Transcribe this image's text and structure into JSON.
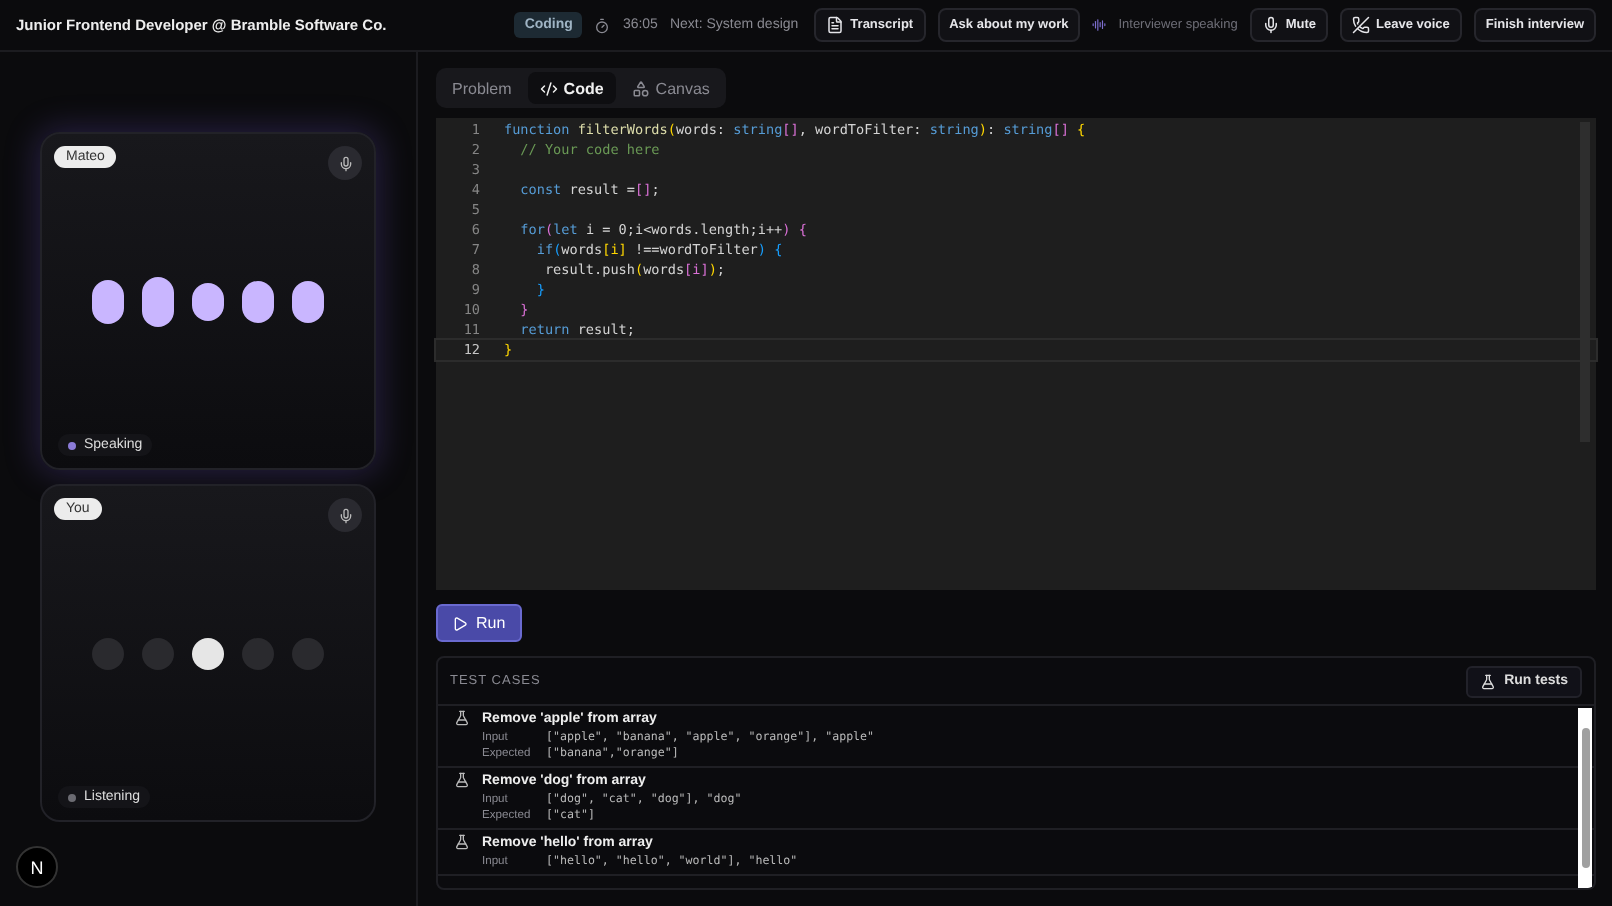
{
  "header": {
    "title": "Junior Frontend Developer @ Bramble Software Co.",
    "phase": "Coding",
    "timer": "36:05",
    "next": "Next: System design",
    "actions": [
      {
        "kind": "button",
        "label": "Transcript"
      },
      {
        "kind": "button",
        "label": "Ask about my work"
      },
      {
        "kind": "status",
        "label": "Interviewer speaking"
      },
      {
        "kind": "button",
        "label": "Mute"
      },
      {
        "kind": "button",
        "label": "Leave voice"
      },
      {
        "kind": "button",
        "label": "Finish interview"
      }
    ]
  },
  "participants": [
    {
      "name": "Mateo",
      "speaking": true,
      "status": "Speaking",
      "color": "#8b7bd8"
    },
    {
      "name": "You",
      "speaking": false,
      "status": "Listening",
      "color": "#6b6b72"
    }
  ],
  "logo": "N",
  "tabs": [
    {
      "label": "Problem",
      "selected": false
    },
    {
      "label": "Code",
      "selected": true
    },
    {
      "label": "Canvas",
      "selected": false
    }
  ],
  "editor": {
    "lines": [
      {
        "number": "1",
        "current": false,
        "tokens": [
          {
            "kind": "kw",
            "text": "function "
          },
          {
            "kind": "fn",
            "text": "filterWords"
          },
          {
            "kind": "br",
            "text": "("
          },
          {
            "kind": "id",
            "text": "words: "
          },
          {
            "kind": "kw",
            "text": "string"
          },
          {
            "kind": "br2",
            "text": "[]"
          },
          {
            "kind": "id",
            "text": ", wordToFilter: "
          },
          {
            "kind": "kw",
            "text": "string"
          },
          {
            "kind": "br",
            "text": ")"
          },
          {
            "kind": "id",
            "text": ": "
          },
          {
            "kind": "kw",
            "text": "string"
          },
          {
            "kind": "br2",
            "text": "[] "
          },
          {
            "kind": "br",
            "text": "{"
          }
        ]
      },
      {
        "number": "2",
        "current": false,
        "tokens": [
          {
            "kind": "cm",
            "text": "  // Your code here"
          }
        ]
      },
      {
        "number": "3",
        "current": false
      },
      {
        "number": "4",
        "current": false,
        "tokens": [
          {
            "kind": "kw",
            "text": "  const "
          },
          {
            "kind": "id",
            "text": "result ="
          },
          {
            "kind": "br2",
            "text": "[]"
          },
          {
            "kind": "id",
            "text": ";"
          }
        ]
      },
      {
        "number": "5",
        "current": false
      },
      {
        "number": "6",
        "current": false,
        "tokens": [
          {
            "kind": "kw",
            "text": "  for"
          },
          {
            "kind": "br2",
            "text": "("
          },
          {
            "kind": "kw",
            "text": "let "
          },
          {
            "kind": "id",
            "text": "i = 0;i<words.length;i++"
          },
          {
            "kind": "br2",
            "text": ") {"
          }
        ]
      },
      {
        "number": "7",
        "current": false,
        "tokens": [
          {
            "kind": "kw",
            "text": "    if"
          },
          {
            "kind": "br3",
            "text": "("
          },
          {
            "kind": "id",
            "text": "words"
          },
          {
            "kind": "br",
            "text": "[i]"
          },
          {
            "kind": "id",
            "text": " !==wordToFilter"
          },
          {
            "kind": "br3",
            "text": ") {"
          }
        ]
      },
      {
        "number": "8",
        "current": false,
        "tokens": [
          {
            "kind": "id",
            "text": "     result.push"
          },
          {
            "kind": "br",
            "text": "("
          },
          {
            "kind": "id",
            "text": "words"
          },
          {
            "kind": "br2",
            "text": "[i]"
          },
          {
            "kind": "br",
            "text": ")"
          },
          {
            "kind": "id",
            "text": ";"
          }
        ]
      },
      {
        "number": "9",
        "current": false,
        "tokens": [
          {
            "kind": "br3",
            "text": "    }"
          }
        ]
      },
      {
        "number": "10",
        "current": false,
        "tokens": [
          {
            "kind": "br2",
            "text": "  }"
          }
        ]
      },
      {
        "number": "11",
        "current": false,
        "tokens": [
          {
            "kind": "kw",
            "text": "  return "
          },
          {
            "kind": "id",
            "text": "result;"
          }
        ]
      },
      {
        "number": "12",
        "current": true,
        "tokens": [
          {
            "kind": "br",
            "text": "}"
          }
        ]
      }
    ]
  },
  "run_button": "Run",
  "tests": {
    "title": "TEST CASES",
    "run_tests": "Run tests",
    "cases": [
      {
        "name": "Remove 'apple' from array",
        "input_label": "Input",
        "input": "[\"apple\", \"banana\", \"apple\", \"orange\"], \"apple\"",
        "expected_label": "Expected",
        "expected": "[\"banana\",\"orange\"]"
      },
      {
        "name": "Remove 'dog' from array",
        "input_label": "Input",
        "input": "[\"dog\", \"cat\", \"dog\"], \"dog\"",
        "expected_label": "Expected",
        "expected": "[\"cat\"]"
      },
      {
        "name": "Remove 'hello' from array",
        "input_label": "Input",
        "input": "[\"hello\", \"hello\", \"world\"], \"hello\""
      }
    ]
  }
}
